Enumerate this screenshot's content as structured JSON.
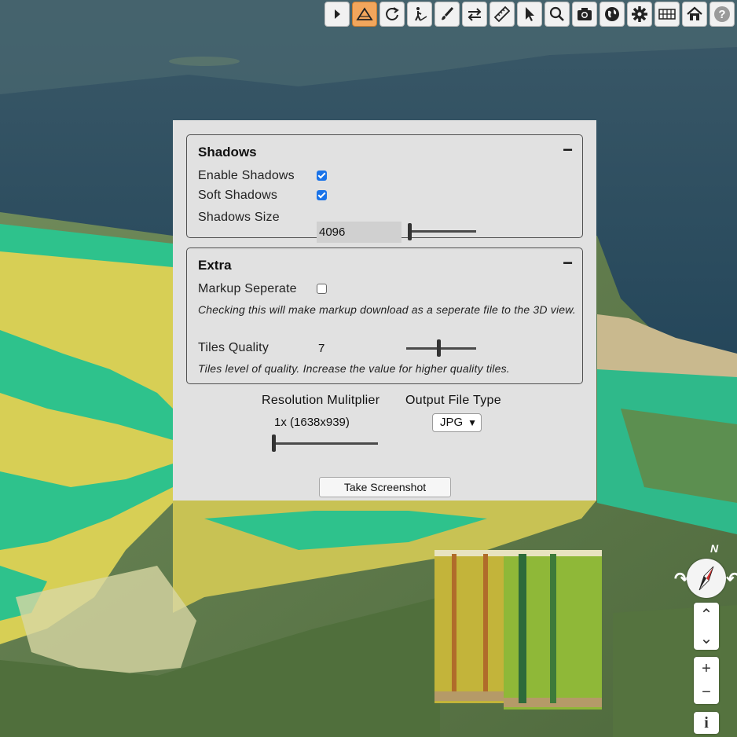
{
  "toolbar": {
    "buttons": [
      {
        "icon": "play-icon"
      },
      {
        "icon": "terrain-icon",
        "active": true
      },
      {
        "icon": "rotate-icon"
      },
      {
        "icon": "walk-icon"
      },
      {
        "icon": "paint-brush-icon"
      },
      {
        "icon": "swap-icon"
      },
      {
        "icon": "ruler-icon"
      },
      {
        "icon": "pointer-icon"
      },
      {
        "icon": "search-icon"
      },
      {
        "icon": "camera-icon"
      },
      {
        "icon": "globe-icon"
      },
      {
        "icon": "gear-icon"
      },
      {
        "icon": "grid-icon"
      },
      {
        "icon": "home-icon"
      },
      {
        "icon": "help-icon"
      }
    ],
    "active_color": "#f2a65c"
  },
  "dialog": {
    "shadows": {
      "title": "Shadows",
      "collapse_symbol": "−",
      "enable_label": "Enable Shadows",
      "enable_checked": true,
      "soft_label": "Soft Shadows",
      "soft_checked": true,
      "size_label": "Shadows Size",
      "size_value": "4096",
      "size_slider_fraction": 0.0
    },
    "extra": {
      "title": "Extra",
      "collapse_symbol": "−",
      "markup_label": "Markup Seperate",
      "markup_checked": false,
      "markup_help": "Checking this will make markup download as a seperate file to the 3D view.",
      "tiles_label": "Tiles Quality",
      "tiles_value": "7",
      "tiles_slider_fraction": 0.45,
      "tiles_help": "Tiles level of quality. Increase the value for higher quality tiles."
    },
    "resolution_label": "Resolution Mulitplier",
    "resolution_value": "1x (1638x939)",
    "resolution_slider_fraction": 0.0,
    "output_label": "Output File Type",
    "output_value": "JPG",
    "screenshot_button": "Take Screenshot",
    "checkbox_color": "#1a73e8"
  },
  "navigation": {
    "north_label": "N",
    "zoom_in": "+",
    "zoom_out": "−",
    "info": "i"
  }
}
